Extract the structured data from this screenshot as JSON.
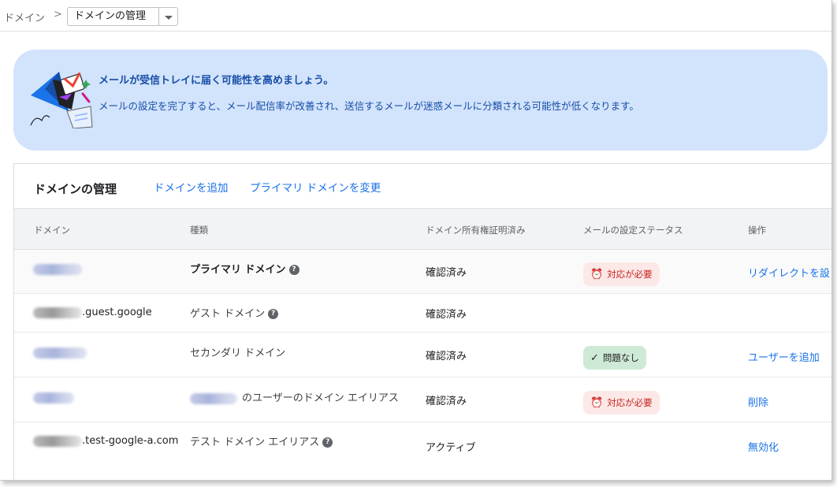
{
  "breadcrumb": {
    "root": "ドメイン",
    "separator": ">",
    "current": "ドメインの管理"
  },
  "banner": {
    "title": "メールが受信トレイに届く可能性を高めましょう。",
    "body": "メールの設定を完了すると、メール配信率が改善され、送信するメールが迷惑メールに分類される可能性が低くなります。"
  },
  "card": {
    "title": "ドメインの管理",
    "actions": [
      "ドメインを追加",
      "プライマリ ドメインを変更"
    ]
  },
  "table": {
    "headers": [
      "ドメイン",
      "種類",
      "ドメイン所有権証明済み",
      "メールの設定ステータス",
      "操作"
    ],
    "rows": [
      {
        "domain_suffix": "",
        "type": "プライマリ ドメイン",
        "verified": "確認済み",
        "status": "対応が必要",
        "action": "リダイレクトを設"
      },
      {
        "domain_suffix": ".guest.google",
        "type": "ゲスト ドメイン",
        "verified": "確認済み",
        "status": "",
        "action": ""
      },
      {
        "domain_suffix": "",
        "type": "セカンダリ ドメイン",
        "verified": "確認済み",
        "status": "問題なし",
        "action": "ユーザーを追加"
      },
      {
        "domain_suffix": "",
        "type": "のユーザーのドメイン エイリアス",
        "verified": "確認済み",
        "status": "対応が必要",
        "action": "削除"
      },
      {
        "domain_suffix": ".test-google-a.com",
        "type": "テスト ドメイン エイリアス",
        "verified": "アクティブ",
        "status": "",
        "action": "無効化"
      }
    ]
  },
  "colors": {
    "accent": "#1a73e8",
    "banner_bg": "#d2e3fc",
    "warn_bg": "#fce8e6",
    "warn_text": "#c5221f",
    "ok_bg": "#ceead6"
  },
  "icons": {
    "breadcrumb_dropdown": "caret-down-icon",
    "banner": "email-illustration-icon",
    "help": "help-icon",
    "warn": "alarm-clock-icon",
    "ok": "check-icon"
  }
}
